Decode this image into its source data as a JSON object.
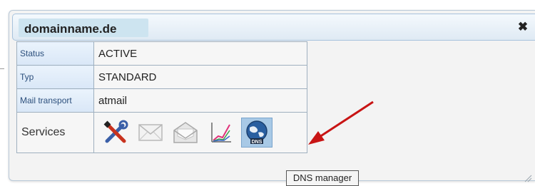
{
  "dialog": {
    "title": "domainname.de",
    "close_symbol": "✖"
  },
  "rows": [
    {
      "label": "Status",
      "value": "ACTIVE"
    },
    {
      "label": "Typ",
      "value": "STANDARD"
    },
    {
      "label": "Mail transport",
      "value": "atmail"
    }
  ],
  "services": {
    "label": "Services",
    "icons": [
      "tools-icon",
      "mail-icon",
      "mail-open-icon",
      "chart-icon",
      "dns-globe-icon"
    ],
    "dns_badge": "DNS"
  },
  "tooltip": "DNS manager"
}
